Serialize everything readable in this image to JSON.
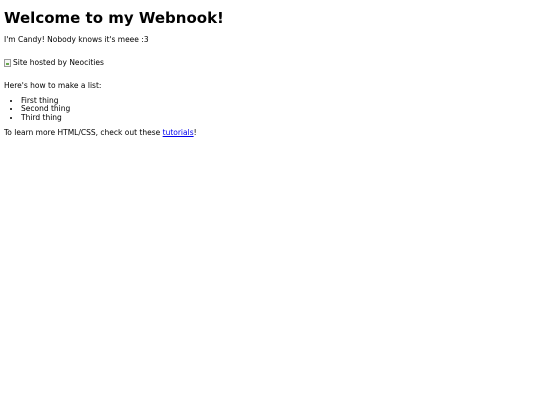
{
  "page": {
    "heading": "Welcome to my Webnook!",
    "intro": "I'm Candy! Nobody knows it's meee :3",
    "image_alt": "Site hosted by Neocities",
    "list_intro": "Here's how to make a list:",
    "list_items": [
      "First thing",
      "Second thing",
      "Third thing"
    ],
    "learn_prefix": "To learn more HTML/CSS, check out these ",
    "learn_link": "tutorials",
    "learn_suffix": "!"
  },
  "colors": {
    "link": "#0000ee",
    "text": "#000000",
    "background": "#ffffff"
  },
  "icons": {
    "broken_image": "broken-image-icon"
  }
}
